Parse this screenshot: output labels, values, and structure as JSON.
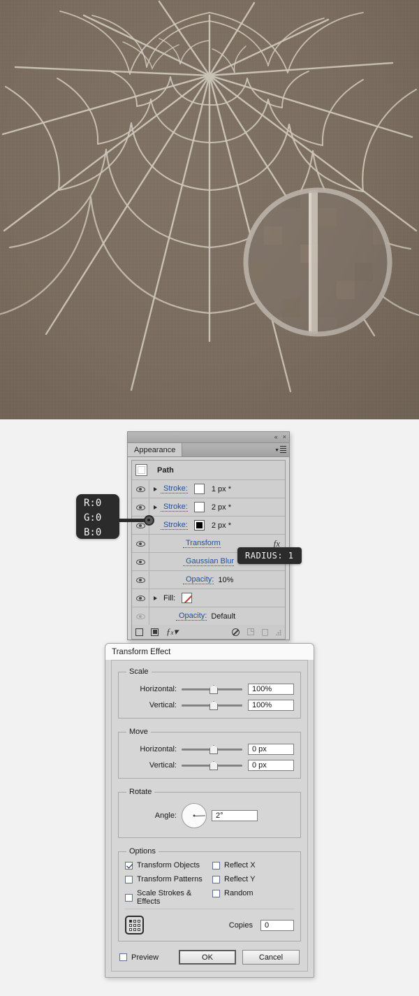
{
  "artwork": {
    "name": "spider-web-illustration",
    "background_color": "#7a6c5d",
    "web_stroke_color": "#cfc7bc",
    "magnifier": {
      "name": "magnifier-circle",
      "ring_color": "#b4aca2"
    }
  },
  "appearance_panel": {
    "titlebar": {
      "collapse_icon": "«",
      "close_icon": "×"
    },
    "tab_label": "Appearance",
    "path_row": {
      "name": "Path"
    },
    "rows": [
      {
        "type": "stroke",
        "label": "Stroke:",
        "value": "1 px *",
        "swatch": "white",
        "eye": true,
        "disclosure": true
      },
      {
        "type": "stroke",
        "label": "Stroke:",
        "value": "2 px *",
        "swatch": "white",
        "eye": true,
        "disclosure": true
      },
      {
        "type": "stroke",
        "label": "Stroke:",
        "value": "2 px *",
        "swatch": "black",
        "eye": true,
        "disclosure": true
      },
      {
        "type": "effect",
        "label": "Transform",
        "value": "",
        "fx": "fx",
        "eye": true,
        "disclosure": false
      },
      {
        "type": "effect",
        "label": "Gaussian Blur",
        "value": "",
        "eye": true,
        "disclosure": false
      },
      {
        "type": "opacity",
        "label": "Opacity:",
        "value": "10%",
        "eye": true,
        "disclosure": false
      },
      {
        "type": "fill",
        "label": "Fill:",
        "value": "",
        "swatch": "none",
        "eye": true,
        "disclosure": true
      },
      {
        "type": "opacity",
        "label": "Opacity:",
        "value": "Default",
        "eye": "dim",
        "disclosure": false
      }
    ],
    "footer_icons": [
      "add-new-stroke-icon",
      "add-new-fill-icon",
      "add-new-effect-icon",
      "clear-appearance-icon",
      "duplicate-item-icon",
      "delete-item-icon",
      "resize-grip-icon"
    ]
  },
  "callouts": {
    "rgb": {
      "r": "R:0",
      "g": "G:0",
      "b": "B:0"
    },
    "radius": "RADIUS: 1"
  },
  "transform_dialog": {
    "title": "Transform Effect",
    "scale": {
      "legend": "Scale",
      "horizontal_label": "Horizontal:",
      "horizontal_value": "100%",
      "vertical_label": "Vertical:",
      "vertical_value": "100%"
    },
    "move": {
      "legend": "Move",
      "horizontal_label": "Horizontal:",
      "horizontal_value": "0 px",
      "vertical_label": "Vertical:",
      "vertical_value": "0 px"
    },
    "rotate": {
      "legend": "Rotate",
      "angle_label": "Angle:",
      "angle_value": "2°"
    },
    "options": {
      "legend": "Options",
      "left": [
        {
          "label": "Transform Objects",
          "checked": true
        },
        {
          "label": "Transform Patterns",
          "checked": false
        },
        {
          "label": "Scale Strokes & Effects",
          "checked": false
        }
      ],
      "right": [
        {
          "label": "Reflect X",
          "checked": false
        },
        {
          "label": "Reflect Y",
          "checked": false
        },
        {
          "label": "Random",
          "checked": false
        }
      ],
      "copies_label": "Copies",
      "copies_value": "0",
      "reference_point": "top-left"
    },
    "footer": {
      "preview_label": "Preview",
      "preview_checked": false,
      "ok_label": "OK",
      "cancel_label": "Cancel"
    }
  }
}
